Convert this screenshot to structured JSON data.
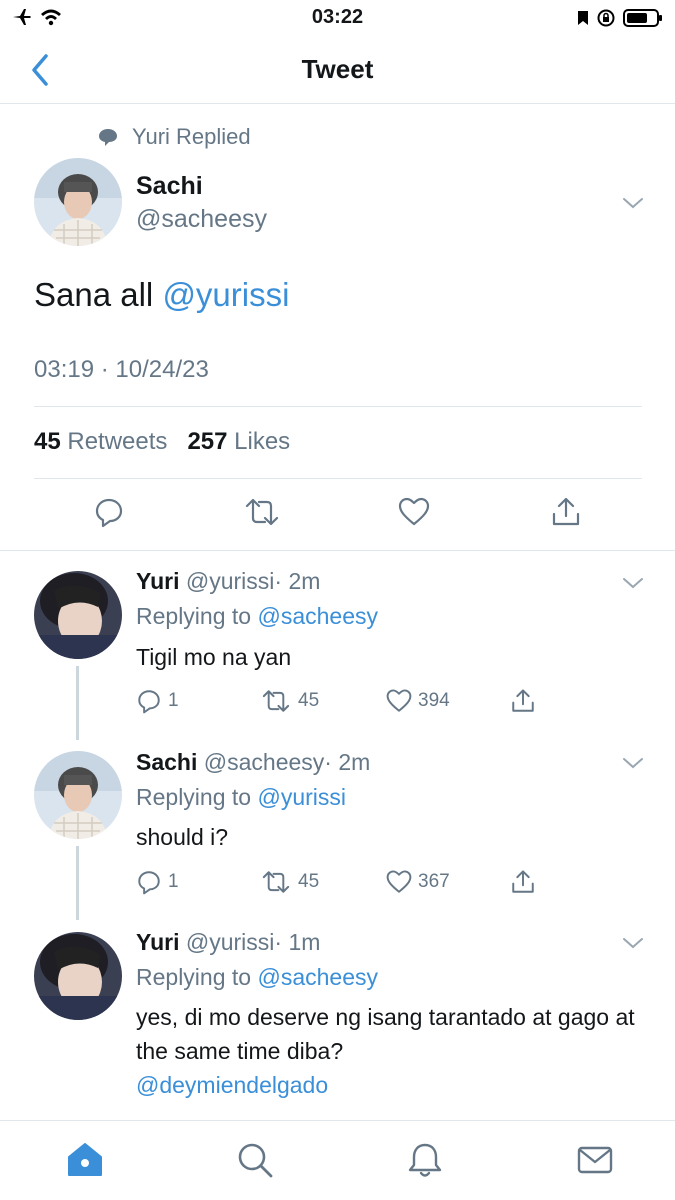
{
  "status_bar": {
    "time": "03:22"
  },
  "nav": {
    "title": "Tweet"
  },
  "main_tweet": {
    "replied_label": "Yuri Replied",
    "author_name": "Sachi",
    "author_handle": "@sacheesy",
    "text": "Sana all ",
    "mention": "@yurissi",
    "timestamp": "03:19 · 10/24/23",
    "retweets_count": "45",
    "retweets_label": "Retweets",
    "likes_count": "257",
    "likes_label": "Likes"
  },
  "replies": [
    {
      "name": "Yuri",
      "handle": "@yurissi",
      "time": "· 2m",
      "replying_label": "Replying to",
      "replying_to": "@sacheesy",
      "text": "Tigil mo na yan",
      "mention": "",
      "replies": "1",
      "retweets": "45",
      "likes": "394"
    },
    {
      "name": "Sachi",
      "handle": "@sacheesy",
      "time": "· 2m",
      "replying_label": "Replying to",
      "replying_to": "@yurissi",
      "text": "should i?",
      "mention": "",
      "replies": "1",
      "retweets": "45",
      "likes": "367"
    },
    {
      "name": "Yuri",
      "handle": "@yurissi",
      "time": "· 1m",
      "replying_label": "Replying to",
      "replying_to": "@sacheesy",
      "text": "yes, di mo deserve ng isang tarantado at gago at the same time diba?",
      "mention": "@deymiendelgado",
      "replies": "",
      "retweets": "",
      "likes": ""
    }
  ],
  "tabs": [
    "home-icon",
    "search-icon",
    "notifications-icon",
    "messages-icon"
  ],
  "colors": {
    "accent": "#3a8fd8",
    "secondary_text": "#657786",
    "divider": "#e1e8ed"
  }
}
